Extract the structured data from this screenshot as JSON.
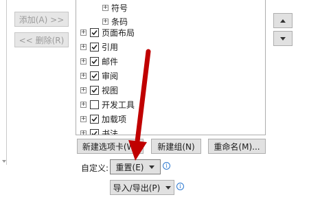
{
  "buttons": {
    "add": "添加(A) >>",
    "remove": "<< 删除(R)",
    "new_tab": "新建选项卡(W)",
    "new_group": "新建组(N)",
    "rename": "重命名(M)...",
    "reset": "重置(E)",
    "import_export": "导入/导出(P)"
  },
  "custom_label": "自定义:",
  "tree": {
    "items": [
      {
        "label": "符号",
        "checkbox": false
      },
      {
        "label": "条码",
        "checkbox": false
      },
      {
        "label": "页面布局",
        "checked": true
      },
      {
        "label": "引用",
        "checked": true
      },
      {
        "label": "邮件",
        "checked": true
      },
      {
        "label": "审阅",
        "checked": true
      },
      {
        "label": "视图",
        "checked": true
      },
      {
        "label": "开发工具",
        "checked": false
      },
      {
        "label": "加载项",
        "checked": true
      },
      {
        "label": "书法",
        "checked": true
      }
    ]
  },
  "icons": {
    "expand": "plus-expander-icon",
    "check": "checkmark-icon",
    "info": "info-icon",
    "move_up": "triangle-up-icon",
    "move_down": "triangle-down-icon",
    "annotation": "red-arrow-annotation",
    "info_glyph": "i"
  },
  "colors": {
    "annotation_arrow": "#c00000",
    "info": "#2b78d0",
    "button_bg": "#e1e1e1"
  }
}
